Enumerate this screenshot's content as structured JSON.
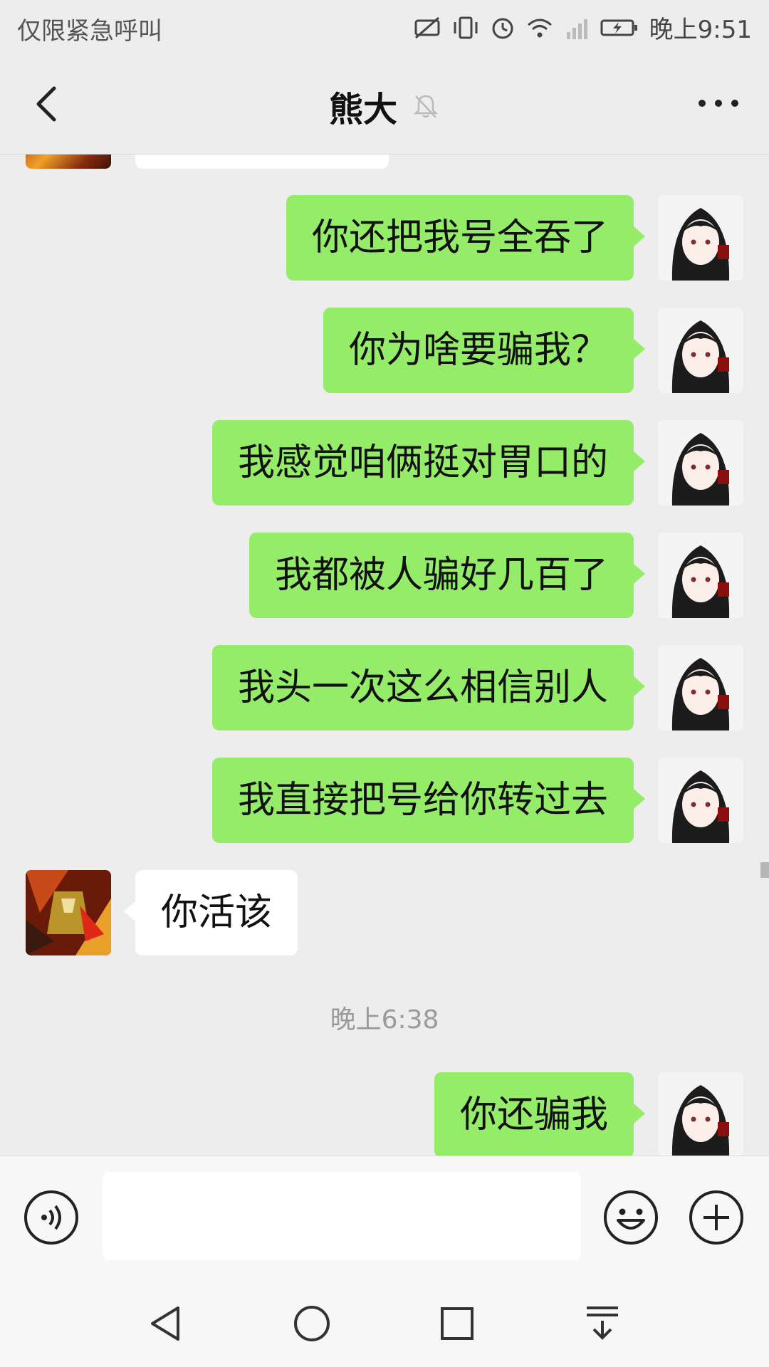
{
  "status_bar": {
    "carrier_text": "仅限紧急呼叫",
    "time": "晚上9:51"
  },
  "header": {
    "title": "熊大",
    "muted": true
  },
  "messages": [
    {
      "side": "self",
      "text": "你还把我号全吞了"
    },
    {
      "side": "self",
      "text": "你为啥要骗我？"
    },
    {
      "side": "self",
      "text": "我感觉咱俩挺对胃口的"
    },
    {
      "side": "self",
      "text": "我都被人骗好几百了"
    },
    {
      "side": "self",
      "text": "我头一次这么相信别人"
    },
    {
      "side": "self",
      "text": "我直接把号给你转过去"
    },
    {
      "side": "other",
      "text": "你活该"
    },
    {
      "type": "timestamp",
      "text": "晚上6:38"
    },
    {
      "side": "self",
      "text": "你还骗我"
    }
  ],
  "input": {
    "placeholder": "",
    "value": ""
  },
  "icons": {
    "back": "back-arrow-icon",
    "mute": "bell-muted-icon",
    "more": "more-dots-icon",
    "voice": "voice-icon",
    "emoji": "emoji-icon",
    "plus": "plus-icon"
  },
  "colors": {
    "self_bubble": "#95ec69",
    "other_bubble": "#ffffff",
    "background": "#ededed"
  }
}
